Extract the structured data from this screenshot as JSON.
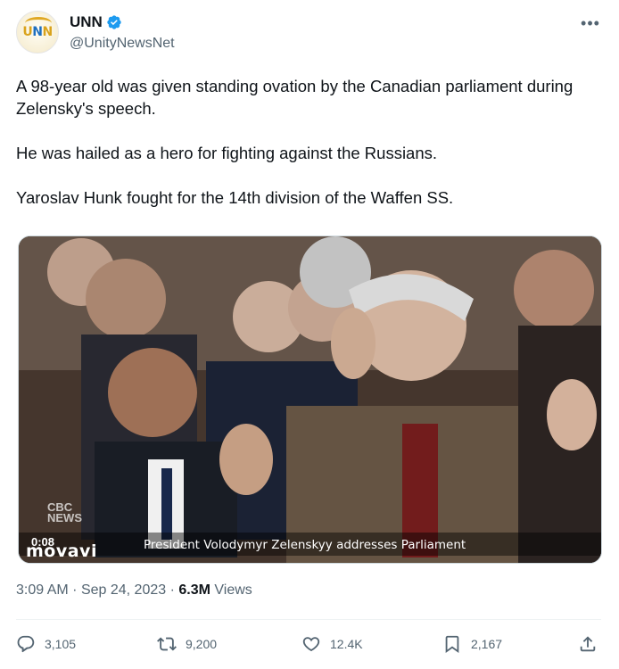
{
  "account": {
    "display_name": "UNN",
    "handle": "@UnityNewsNet",
    "avatar_text": [
      "U",
      "N",
      "N"
    ],
    "verified": true
  },
  "tweet": {
    "paragraphs": [
      "A 98-year old was given standing ovation by the Canadian parliament during Zelensky's speech.",
      "He was hailed as a hero for fighting against the Russians.",
      "Yaroslav Hunk fought for the 14th division of the Waffen SS."
    ]
  },
  "media": {
    "watermark": [
      "CBC",
      "NEWS"
    ],
    "timestamp": "0:08",
    "caption": "President Volodymyr Zelenskyy addresses Parliament",
    "overlay_brand": "movavi"
  },
  "meta": {
    "time": "3:09 AM",
    "date": "Sep 24, 2023",
    "views_count": "6.3M",
    "views_label": "Views"
  },
  "actions": {
    "replies": "3,105",
    "reposts": "9,200",
    "likes": "12.4K",
    "bookmarks": "2,167"
  },
  "colors": {
    "text": "#0f1419",
    "secondary": "#536471",
    "verified": "#1d9bf0",
    "border": "#cfd9de"
  }
}
